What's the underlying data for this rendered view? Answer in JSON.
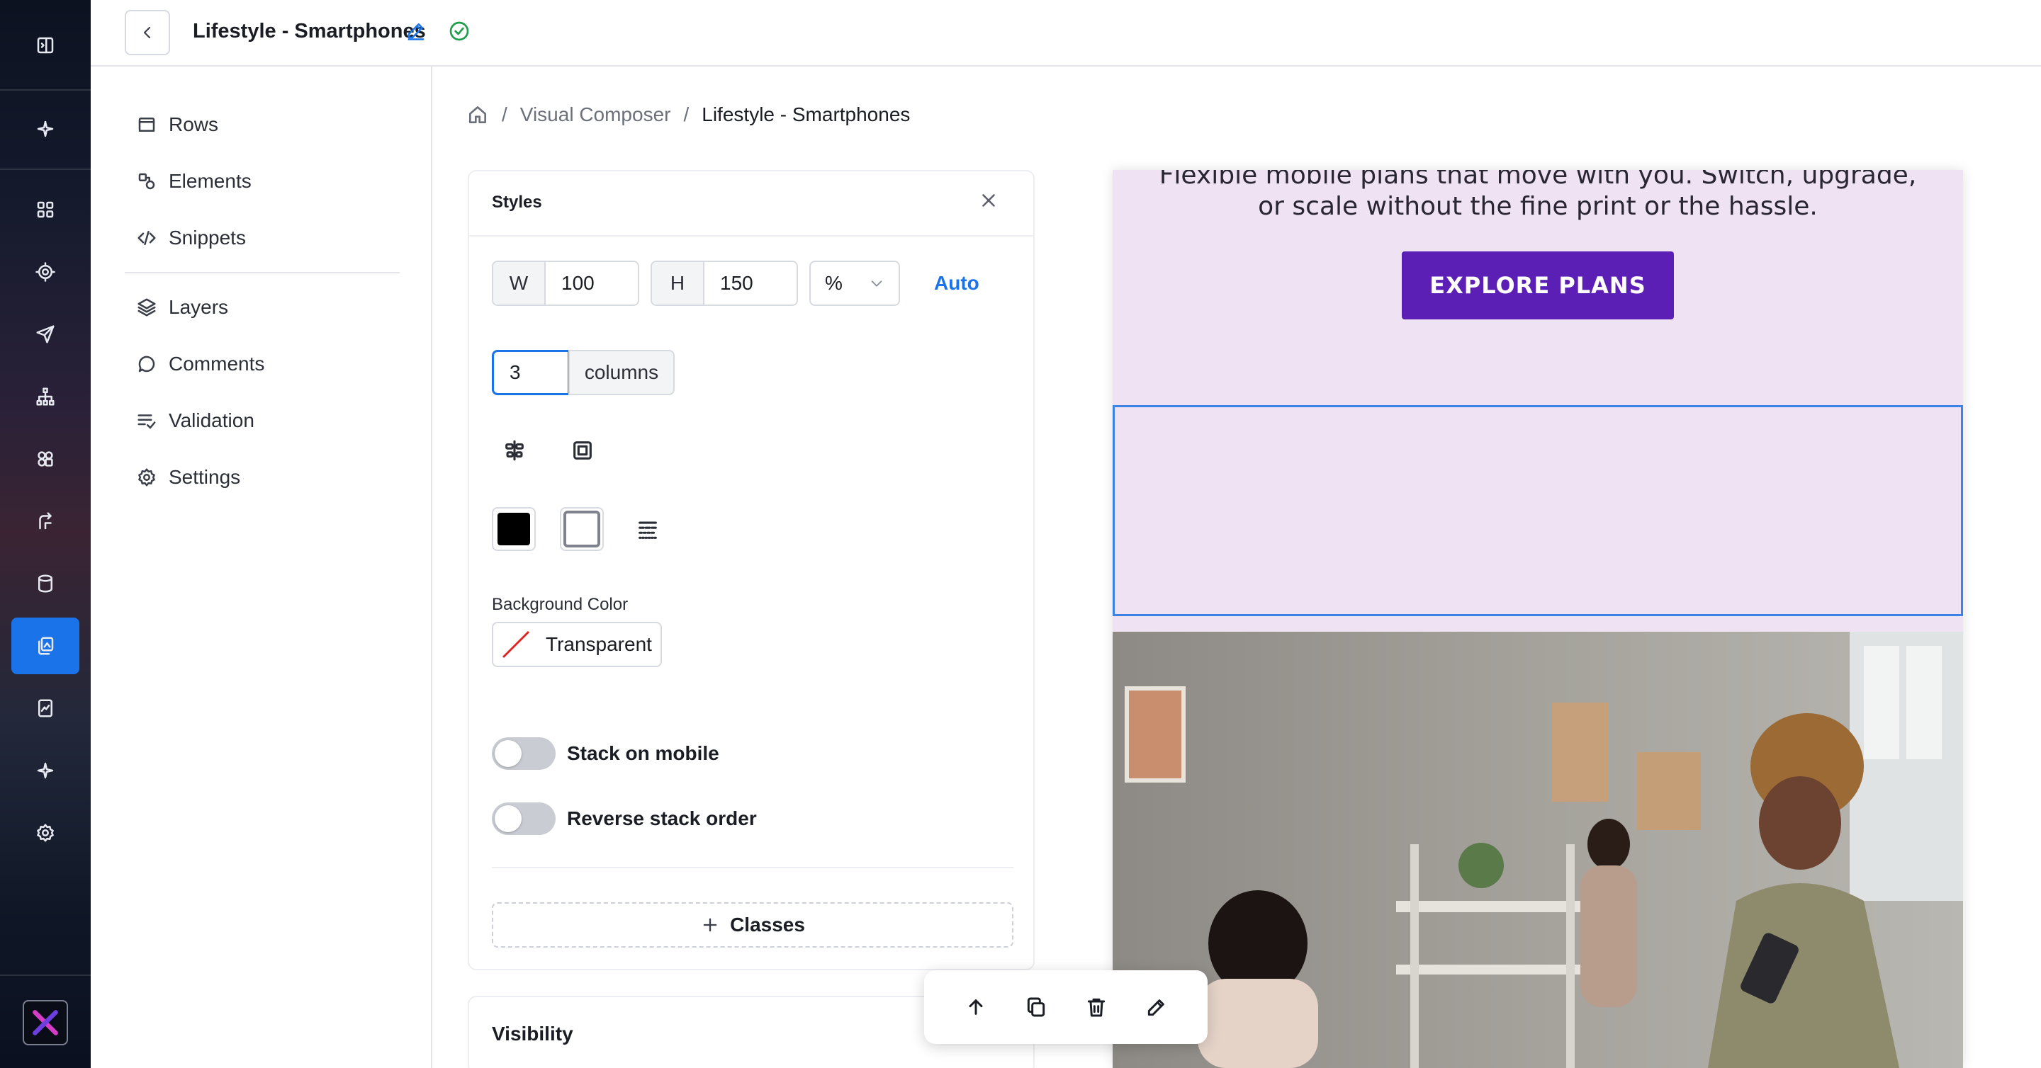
{
  "header": {
    "title": "Lifestyle - Smartphones"
  },
  "sidebar": {
    "items": [
      {
        "label": "Rows",
        "icon": "rows-icon"
      },
      {
        "label": "Elements",
        "icon": "elements-icon"
      },
      {
        "label": "Snippets",
        "icon": "code-icon"
      },
      {
        "label": "Layers",
        "icon": "layers-icon"
      },
      {
        "label": "Comments",
        "icon": "comment-icon"
      },
      {
        "label": "Validation",
        "icon": "validation-icon"
      },
      {
        "label": "Settings",
        "icon": "gear-icon"
      }
    ]
  },
  "breadcrumb": {
    "items": [
      "Visual Composer",
      "Lifestyle - Smartphones"
    ]
  },
  "styles": {
    "title": "Styles",
    "width_prefix": "W",
    "width_value": "100",
    "height_prefix": "H",
    "height_value": "150",
    "unit": "%",
    "auto_label": "Auto",
    "columns_value": "3",
    "columns_label": "columns",
    "bg_color_label": "Background Color",
    "bg_color_value": "Transparent",
    "stack_mobile_label": "Stack on mobile",
    "reverse_stack_label": "Reverse stack order",
    "classes_label": "Classes"
  },
  "visibility": {
    "title": "Visibility"
  },
  "canvas": {
    "hero_line1": "Flexible mobile plans that move with you. Switch, upgrade,",
    "hero_line2": "or scale without the fine print or the hassle.",
    "cta_label": "EXPLORE PLANS",
    "background": "#efe2f3",
    "cta_color": "#5b1fb6"
  },
  "colors": {
    "accent": "#1a73e8",
    "rail_active": "#1a73e8",
    "status_ok": "#1e9e4a"
  }
}
